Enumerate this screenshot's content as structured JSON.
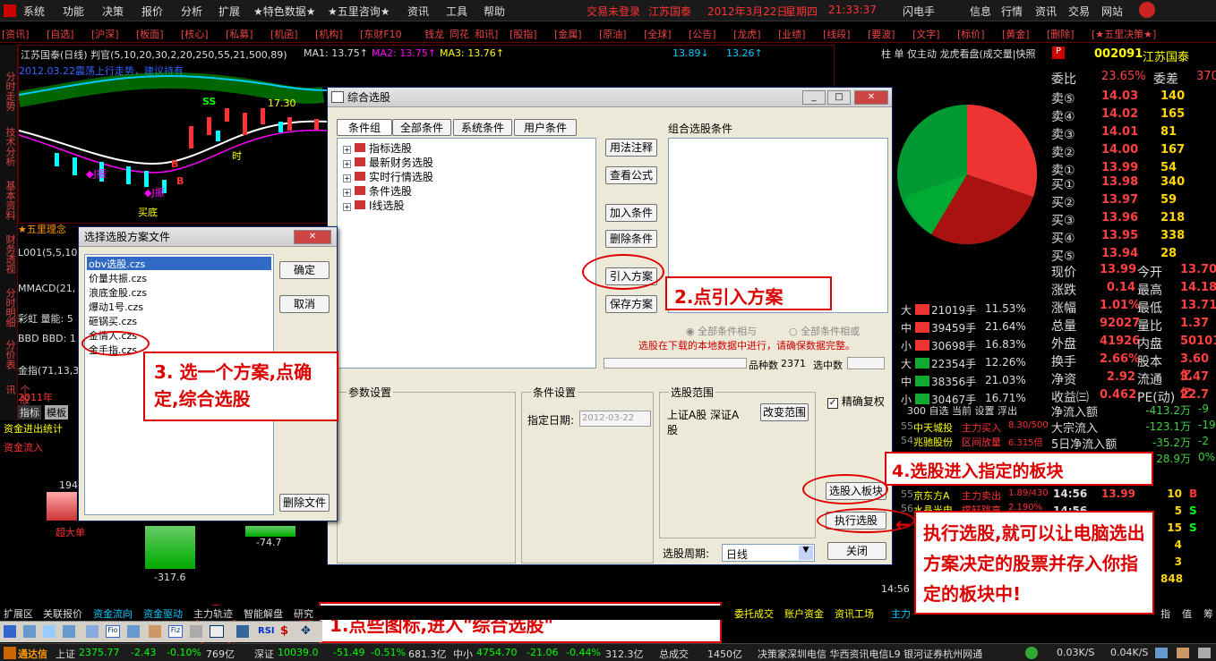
{
  "menu": {
    "items": [
      "系统",
      "功能",
      "决策",
      "报价",
      "分析",
      "扩展",
      "★特色数据★",
      "★五里咨询★",
      "资讯",
      "工具",
      "帮助"
    ],
    "status_red": "交易未登录",
    "stock_name": "江苏国泰",
    "date": "2012年3月22日",
    "weekday": "星期四",
    "time": "21:33:37",
    "right_items": [
      "闪电手",
      "信息",
      "行情",
      "资讯",
      "交易",
      "网站"
    ]
  },
  "tabs": [
    "[资讯]",
    "[自选]",
    "[沪深]",
    "[板面]",
    "[核心]",
    "[私募]",
    "[机函]",
    "[机构]",
    "[东财F10",
    "钱龙",
    "同花",
    "和讯]",
    "[股指]",
    "[金属]",
    "[原油]",
    "[全球]",
    "[公告]",
    "[龙虎]",
    "[业绩]",
    "[线段]",
    "[要波]",
    "[文字]",
    "[标价]",
    "[黄金]",
    "[删除]",
    "[★五里决策★]"
  ],
  "chart": {
    "title": "江苏国泰(日线) 判官(5,10,20,30,2,20,250,55,21,500,89)",
    "ma1": "MA1: 13.75↑",
    "ma2": "MA2: 13.75↑",
    "ma3": "MA3: 13.76↑",
    "v1": "13.89↓",
    "v2": "13.26↑",
    "note": "2012.03.22震荡上行走势，建议持有",
    "price_label": "17.30",
    "ss": "SS",
    "label_j1": "◆J振",
    "label_j2": "◆J振",
    "label_bottom": "买底",
    "label_b1": "B",
    "label_b2": "B",
    "label_time": "时"
  },
  "leftstrip": [
    "分时走势",
    "技术分析",
    "基本资料",
    "财务透视",
    "分时明细",
    "分价表",
    "个股资讯"
  ],
  "left_labels": {
    "wuli": "★五里理念",
    "l001": "L001(5,5,10",
    "mmacd": "MMACD(21,",
    "caihong": "彩虹 量能: 5",
    "bbd": "BBD BBD: 1",
    "jinzhi": "金指(71,13,3",
    "year": "2011年",
    "tab1": "指标",
    "tab2": "模板",
    "capital": "资金进出统计",
    "inflow": "资金流入",
    "v194": "194",
    "super": "超大单",
    "v317": "-317.6",
    "v747": "-74.7"
  },
  "main_dialog": {
    "title": "综合选股",
    "tabs": [
      "条件组",
      "全部条件",
      "系统条件",
      "用户条件"
    ],
    "tree": [
      "指标选股",
      "最新财务选股",
      "实时行情选股",
      "条件选股",
      "Ⅰ线选股"
    ],
    "btn_usage": "用法注释",
    "btn_formula": "查看公式",
    "btn_add": "加入条件",
    "btn_delete": "删除条件",
    "btn_import": "引入方案",
    "btn_save": "保存方案",
    "combo_label": "组合选股条件",
    "radio_and": "全部条件相与",
    "radio_or": "全部条件相或",
    "warn": "选股在下载的本地数据中进行，请确保数据完整。",
    "count_label": "品种数",
    "count_value": "2371",
    "selected_label": "选中数",
    "param_label": "参数设置",
    "cond_label": "条件设置",
    "date_label": "指定日期:",
    "date_value": "2012-03-22",
    "range_label": "选股范围",
    "range_value": "上证A股  深证A股",
    "btn_change": "改变范围",
    "checkbox_label": "精确复权",
    "btn_to_block": "选股入板块",
    "btn_exec": "执行选股",
    "period_label": "选股周期:",
    "period_value": "日线",
    "btn_close": "关闭"
  },
  "file_dialog": {
    "title": "选择选股方案文件",
    "files": [
      "obv选股.czs",
      "价量共振.czs",
      "浪底金股.czs",
      "爆动1号.czs",
      "砸锅买.czs",
      "金情人.czs",
      "金手指.czs"
    ],
    "btn_ok": "确定",
    "btn_cancel": "取消",
    "btn_delete": "删除文件"
  },
  "callouts": {
    "c1": "1.点些图标,进入\"综合选股\"",
    "c2": "2.点引入方案",
    "c3": "3. 选一个方案,点确定,综合选股",
    "c4": "4.选股进入指定的板块",
    "c5": "执行选股,就可以让电脑选出方案决定的股票并存入你指定的板块中!"
  },
  "right": {
    "header": "柱 单 仅主动 龙虎看盘(成交量|快照",
    "code": "002091",
    "name": "江苏国泰",
    "weibi": "委比",
    "weibi_v": "23.65%",
    "weicha": "委差",
    "weicha_v": "370",
    "sells": [
      {
        "l": "卖⑤",
        "p": "14.03",
        "v": "140"
      },
      {
        "l": "卖④",
        "p": "14.02",
        "v": "165"
      },
      {
        "l": "卖③",
        "p": "14.01",
        "v": "81"
      },
      {
        "l": "卖②",
        "p": "14.00",
        "v": "167"
      },
      {
        "l": "卖①",
        "p": "13.99",
        "v": "54"
      }
    ],
    "buys": [
      {
        "l": "买①",
        "p": "13.98",
        "v": "340"
      },
      {
        "l": "买②",
        "p": "13.97",
        "v": "59"
      },
      {
        "l": "买③",
        "p": "13.96",
        "v": "218"
      },
      {
        "l": "买④",
        "p": "13.95",
        "v": "338"
      },
      {
        "l": "买⑤",
        "p": "13.94",
        "v": "28"
      }
    ],
    "stats": [
      {
        "a": "现价",
        "av": "13.99",
        "b": "今开",
        "bv": "13.70"
      },
      {
        "a": "涨跌",
        "av": "0.14",
        "b": "最高",
        "bv": "14.18"
      },
      {
        "a": "涨幅",
        "av": "1.01%",
        "b": "最低",
        "bv": "13.71"
      },
      {
        "a": "总量",
        "av": "92027",
        "b": "量比",
        "bv": "1.37"
      },
      {
        "a": "外盘",
        "av": "41926",
        "b": "内盘",
        "bv": "50101"
      },
      {
        "a": "换手",
        "av": "2.66%",
        "b": "股本",
        "bv": "3.60亿"
      },
      {
        "a": "净资",
        "av": "2.92",
        "b": "流通",
        "bv": "3.47亿"
      },
      {
        "a": "收益㈢",
        "av": "0.462",
        "b": "PE(动)",
        "bv": "22.7"
      }
    ],
    "flows": [
      {
        "a": "净流入额",
        "v": "-413.2万",
        "t": "-9"
      },
      {
        "a": "大宗流入",
        "v": "-123.1万",
        "t": "-19"
      },
      {
        "a": "5日净流入额",
        "v": "-35.2万",
        "t": "-2"
      },
      {
        "a": "",
        "v": "28.9万",
        "t": "0%"
      }
    ],
    "trades": [
      {
        "t": "14:56",
        "p": "13.99",
        "v": "10",
        "s": "B"
      },
      {
        "t": "14:56",
        "p": "",
        "v": "5",
        "s": "S"
      },
      {
        "t": "",
        "p": "",
        "v": "15",
        "s": "S"
      },
      {
        "t": "",
        "p": "",
        "v": "4",
        "s": ""
      },
      {
        "t": "",
        "p": "",
        "v": "3",
        "s": ""
      },
      {
        "t": "",
        "p": "",
        "v": "848",
        "s": ""
      }
    ],
    "volrows": [
      {
        "l": "大",
        "v": "21019手",
        "p": "11.53%"
      },
      {
        "l": "中",
        "v": "39459手",
        "p": "21.64%"
      },
      {
        "l": "小",
        "v": "30698手",
        "p": "16.83%"
      },
      {
        "l": "大",
        "v": "22354手",
        "p": "12.26%"
      },
      {
        "l": "中",
        "v": "38356手",
        "p": "21.03%"
      },
      {
        "l": "小",
        "v": "30467手",
        "p": "16.71%"
      }
    ],
    "ticker_head": "300 自选 当前 设置 浮出",
    "ticker": [
      {
        "c": "55",
        "n": "中天城投",
        "s": "主力买入",
        "v": "8.30/500"
      },
      {
        "c": "54",
        "n": "兆驰股份",
        "s": "区间放量",
        "v": "6.315倍"
      },
      {
        "c": "55",
        "n": "京东方A",
        "s": "主力卖出",
        "v": "1.89/430"
      },
      {
        "c": "56",
        "n": "水晶光电",
        "s": "撑轩跳高",
        "v": "2.190%"
      }
    ],
    "time_bottom": "14:56"
  },
  "bottomtabs": [
    "扩展区",
    "关联报价",
    "资金流向",
    "资金驱动",
    "主力轨迹",
    "智能解盘",
    "研究"
  ],
  "bottomtabs_right": [
    "委托成交",
    "账户资金",
    "资讯工场",
    "主力"
  ],
  "bottom_right_labels": [
    "指",
    "值",
    "筹"
  ],
  "status": {
    "brand": "通达信",
    "sh": "上证",
    "sh_v": "2375.77",
    "sh_c": "-2.43",
    "sh_p": "-0.10%",
    "sh_a": "769亿",
    "sz": "深证",
    "sz_v": "10039.0",
    "sz_c": "-51.49",
    "sz_p": "-0.51%",
    "sz_a": "681.3亿",
    "zx": "中小",
    "zx_v": "4754.70",
    "zx_c": "-21.06",
    "zx_p": "-0.44%",
    "zx_a": "312.3亿",
    "zc": "总成交",
    "zc_v": "1450亿",
    "server": "决策家深圳电信 华西资讯电信L9 银河证券杭州网通",
    "speed1": "0.03K/S",
    "speed2": "0.04K/S"
  }
}
